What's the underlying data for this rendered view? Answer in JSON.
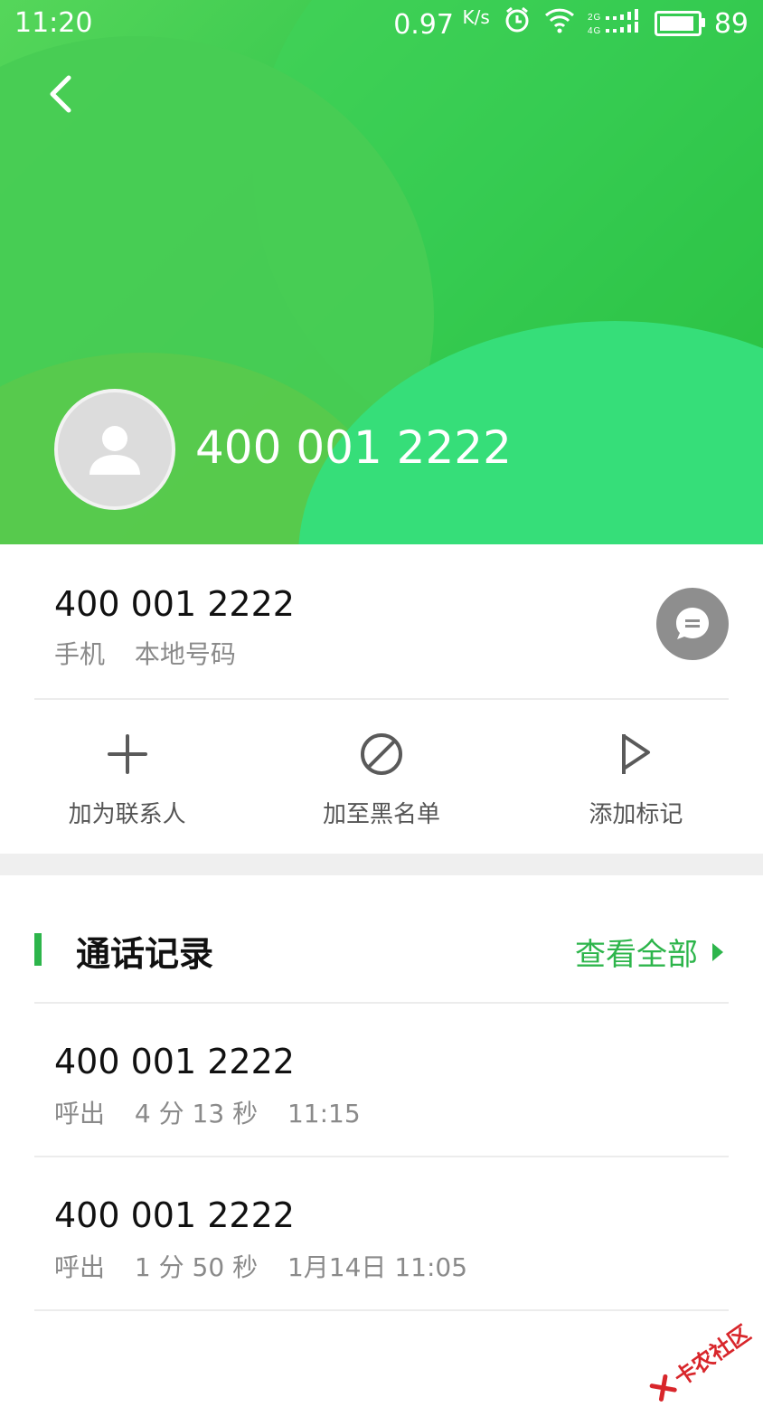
{
  "status_bar": {
    "time": "11:20",
    "speed": "0.97",
    "speed_unit": "K/s",
    "network": "2G 4G",
    "battery": "89"
  },
  "header": {
    "number": "400 001 2222",
    "icons": [
      "back-arrow-icon",
      "person-icon"
    ]
  },
  "number_card": {
    "number": "400 001 2222",
    "type": "手机",
    "location": "本地号码",
    "message_icon": "message-icon"
  },
  "actions": [
    {
      "label": "加为联系人",
      "icon": "plus-icon"
    },
    {
      "label": "加至黑名单",
      "icon": "block-icon"
    },
    {
      "label": "添加标记",
      "icon": "flag-icon"
    }
  ],
  "call_log": {
    "title": "通话记录",
    "view_all": "查看全部",
    "items": [
      {
        "number": "400 001 2222",
        "direction": "呼出",
        "duration": "4 分 13 秒",
        "time": "11:15"
      },
      {
        "number": "400 001 2222",
        "direction": "呼出",
        "duration": "1 分 50 秒",
        "time": "1月14日 11:05"
      }
    ]
  },
  "watermark": "卡农社区",
  "colors": {
    "accent": "#2db54b",
    "header_green": "#3ed35a",
    "gray_text": "#8a8a8a"
  }
}
